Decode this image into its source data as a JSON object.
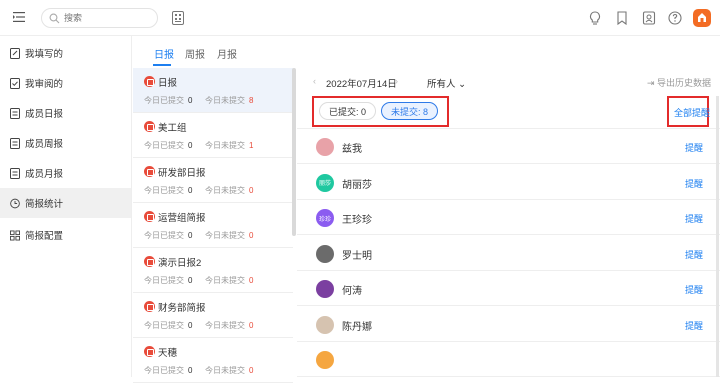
{
  "search": {
    "placeholder": "搜索"
  },
  "sidebar": {
    "items": [
      {
        "label": "我填写的",
        "icon": "edit-doc-icon"
      },
      {
        "label": "我审阅的",
        "icon": "review-doc-icon"
      },
      {
        "label": "成员日报",
        "icon": "doc-icon"
      },
      {
        "label": "成员周报",
        "icon": "doc-icon"
      },
      {
        "label": "成员月报",
        "icon": "doc-icon"
      },
      {
        "label": "简报统计",
        "icon": "clock-icon"
      },
      {
        "label": "简报配置",
        "icon": "grid-icon"
      }
    ],
    "active_index": 5
  },
  "tabs": [
    {
      "label": "日报"
    },
    {
      "label": "周报"
    },
    {
      "label": "月报"
    }
  ],
  "reports": [
    {
      "title": "日报",
      "submitted_label": "今日已提交",
      "submitted": "0",
      "unsubmitted_label": "今日未提交",
      "unsubmitted": "8"
    },
    {
      "title": "美工组",
      "submitted_label": "今日已提交",
      "submitted": "0",
      "unsubmitted_label": "今日未提交",
      "unsubmitted": "1"
    },
    {
      "title": "研发部日报",
      "submitted_label": "今日已提交",
      "submitted": "0",
      "unsubmitted_label": "今日未提交",
      "unsubmitted": "0"
    },
    {
      "title": "运营组简报",
      "submitted_label": "今日已提交",
      "submitted": "0",
      "unsubmitted_label": "今日未提交",
      "unsubmitted": "0"
    },
    {
      "title": "演示日报2",
      "submitted_label": "今日已提交",
      "submitted": "0",
      "unsubmitted_label": "今日未提交",
      "unsubmitted": "0"
    },
    {
      "title": "财务部简报",
      "submitted_label": "今日已提交",
      "submitted": "0",
      "unsubmitted_label": "今日未提交",
      "unsubmitted": "0"
    },
    {
      "title": "天穗",
      "submitted_label": "今日已提交",
      "submitted": "0",
      "unsubmitted_label": "今日未提交",
      "unsubmitted": "0"
    }
  ],
  "main": {
    "date": "2022年07月14日",
    "people_filter": "所有人",
    "export_label": "导出历史数据",
    "submitted_chip": "已提交: 0",
    "unsubmitted_chip": "未提交: 8",
    "remind_all": "全部提醒",
    "members": [
      {
        "name": "兹我",
        "avatar_text": "",
        "avatar_color": "#e8a2a8",
        "remind": "提醒"
      },
      {
        "name": "胡丽莎",
        "avatar_text": "丽莎",
        "avatar_color": "#1fc8a0",
        "remind": "提醒"
      },
      {
        "name": "王珍珍",
        "avatar_text": "珍珍",
        "avatar_color": "#8b5cf0",
        "remind": "提醒"
      },
      {
        "name": "罗士明",
        "avatar_text": "",
        "avatar_color": "#6b6b6b",
        "remind": "提醒"
      },
      {
        "name": "何涛",
        "avatar_text": "",
        "avatar_color": "#7b3fa0",
        "remind": "提醒"
      },
      {
        "name": "陈丹娜",
        "avatar_text": "",
        "avatar_color": "#d6c3b0",
        "remind": "提醒"
      },
      {
        "name": "",
        "avatar_text": "",
        "avatar_color": "#f5a640",
        "remind": ""
      }
    ]
  },
  "colors": {
    "accent": "#1d7ff0",
    "danger": "#e84b3a",
    "highlight_box": "#e32b2b"
  }
}
